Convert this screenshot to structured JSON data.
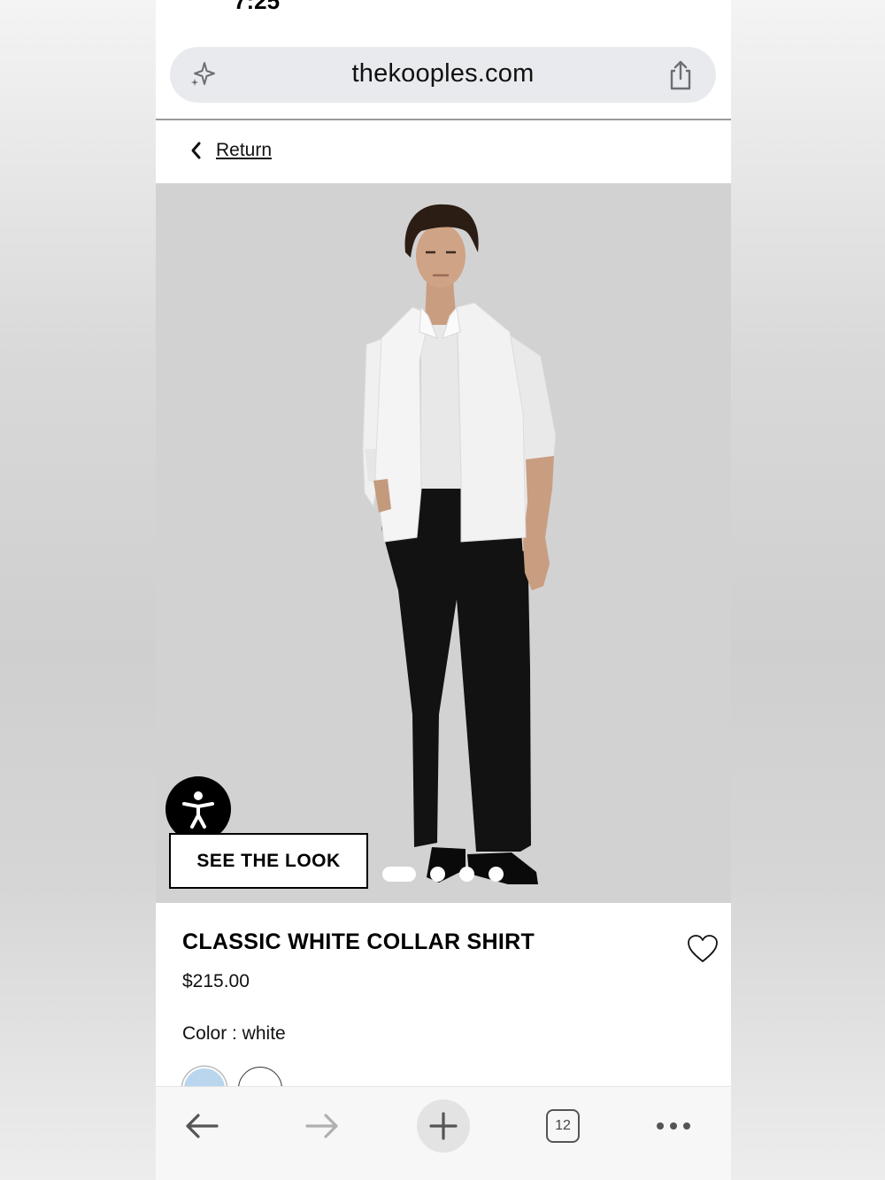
{
  "status_bar": {
    "time": "7:25"
  },
  "browser": {
    "url": "thekooples.com",
    "tab_count": "12",
    "icons": {
      "sparkle": "sparkle-icon",
      "share": "share-icon",
      "back": "arrow-left-icon",
      "forward": "arrow-right-icon",
      "new_tab": "plus-icon",
      "tabs": "tabs-icon",
      "more": "more-dots-icon"
    }
  },
  "page": {
    "return_label": "Return",
    "see_the_look_label": "SEE THE LOOK",
    "carousel": {
      "count": 4,
      "active": 0
    },
    "product": {
      "name": "CLASSIC WHITE COLLAR SHIRT",
      "price": "$215.00",
      "color_label": "Color : white",
      "swatches": [
        {
          "name": "light blue",
          "hex": "#b9d6ee"
        },
        {
          "name": "white",
          "hex": "#ffffff"
        }
      ]
    }
  },
  "colors": {
    "hero_background": "#d2d2d2",
    "address_bar": "#e8eaed",
    "text": "#000000"
  }
}
